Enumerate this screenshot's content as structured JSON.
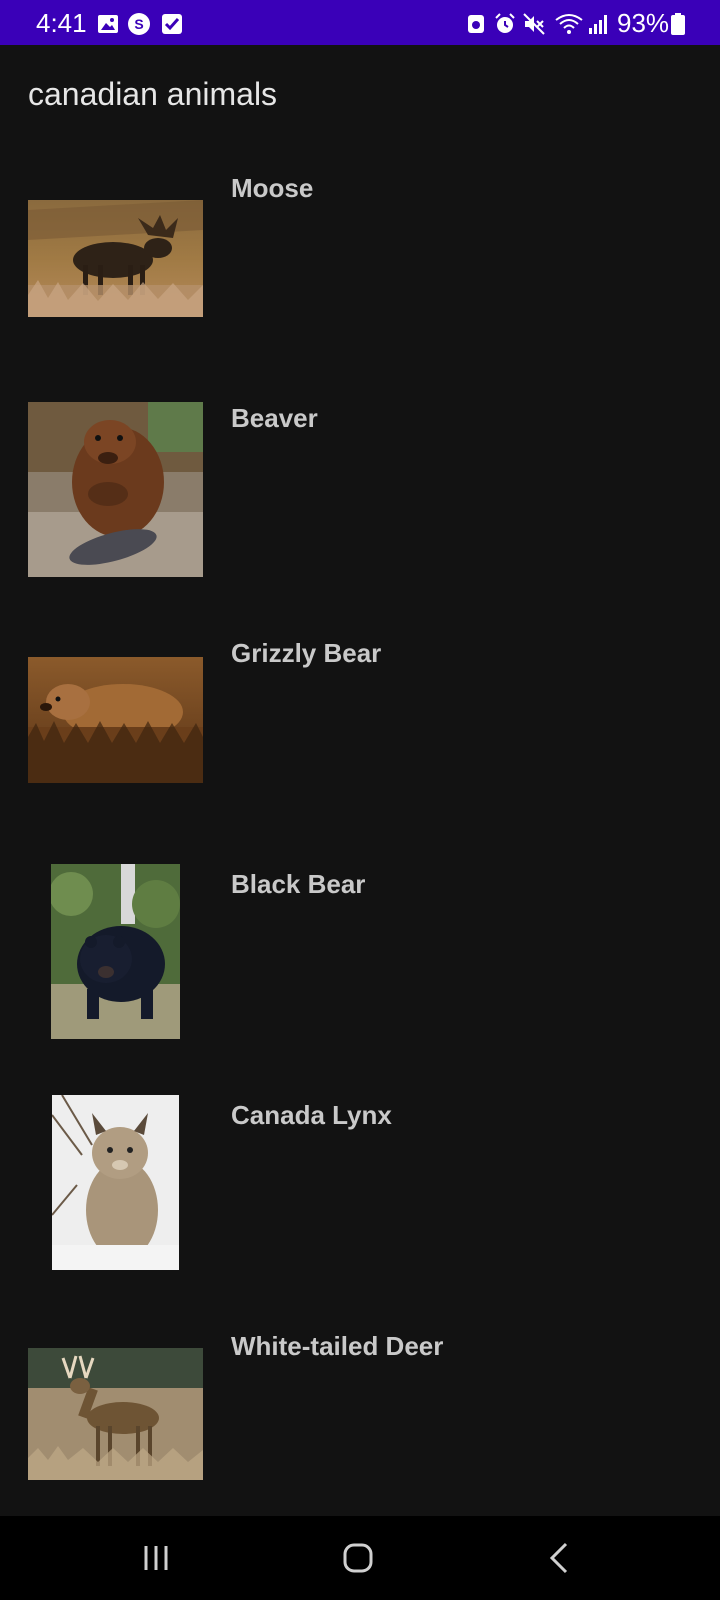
{
  "status_bar": {
    "time": "4:41",
    "battery_percent": "93%",
    "left_icons": [
      "gallery-icon",
      "s-app-icon",
      "checkbox-icon"
    ],
    "right_icons": [
      "android-badge-icon",
      "alarm-icon",
      "mute-icon",
      "wifi-icon",
      "signal-icon",
      "battery-icon"
    ],
    "color": "#3a00b8"
  },
  "app": {
    "title": "canadian animals"
  },
  "animals": [
    {
      "name": "Moose",
      "image": "moose-photo"
    },
    {
      "name": "Beaver",
      "image": "beaver-photo"
    },
    {
      "name": "Grizzly Bear",
      "image": "grizzly-bear-photo"
    },
    {
      "name": "Black Bear",
      "image": "black-bear-photo"
    },
    {
      "name": "Canada Lynx",
      "image": "canada-lynx-photo"
    },
    {
      "name": "White-tailed Deer",
      "image": "white-tailed-deer-photo"
    }
  ],
  "nav_bar": {
    "buttons": [
      "recents-icon",
      "home-icon",
      "back-icon"
    ]
  }
}
